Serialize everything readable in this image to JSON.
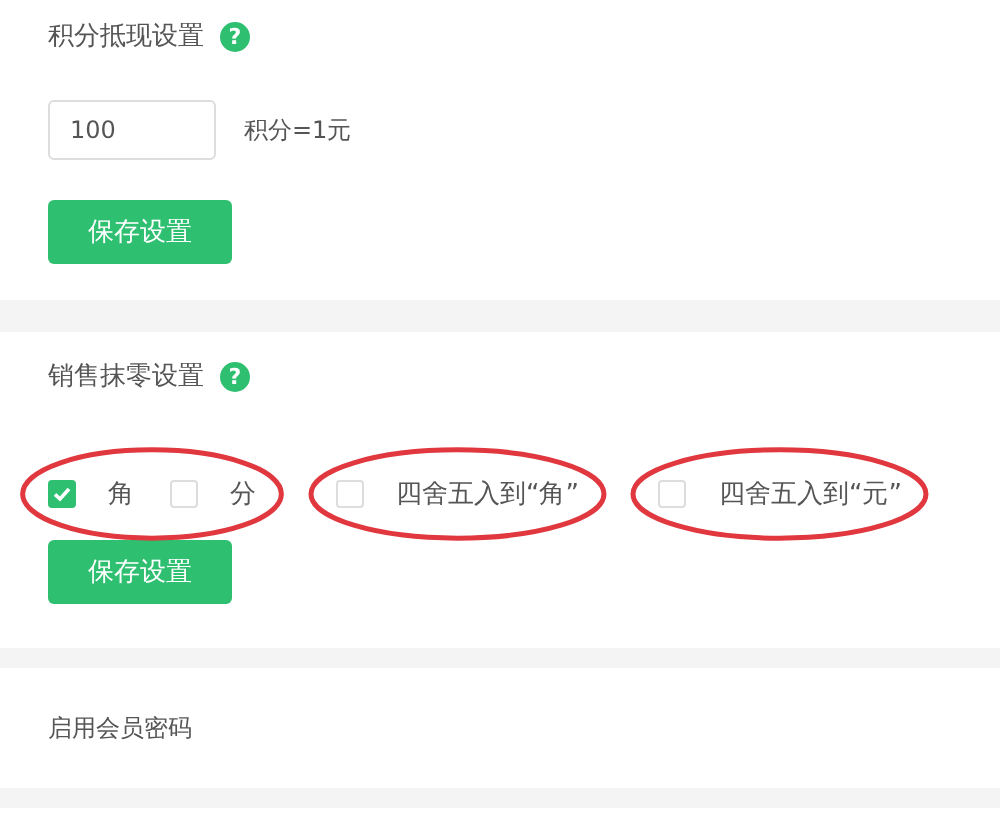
{
  "points_section": {
    "title": "积分抵现设置",
    "help": "?",
    "input": {
      "value": "100"
    },
    "unit": "积分=1元",
    "button": "保存设置"
  },
  "rounding_section": {
    "title": "销售抹零设置",
    "help": "?",
    "option_groups": [
      {
        "circled": true,
        "options": [
          {
            "label": "角",
            "checked": true
          },
          {
            "label": "分",
            "checked": false
          }
        ]
      },
      {
        "circled": true,
        "options": [
          {
            "label": "四舍五入到“角”",
            "checked": false
          }
        ]
      },
      {
        "circled": true,
        "options": [
          {
            "label": "四舍五入到“元”",
            "checked": false
          }
        ]
      }
    ],
    "button": "保存设置"
  },
  "password_section": {
    "title": "启用会员密码"
  }
}
